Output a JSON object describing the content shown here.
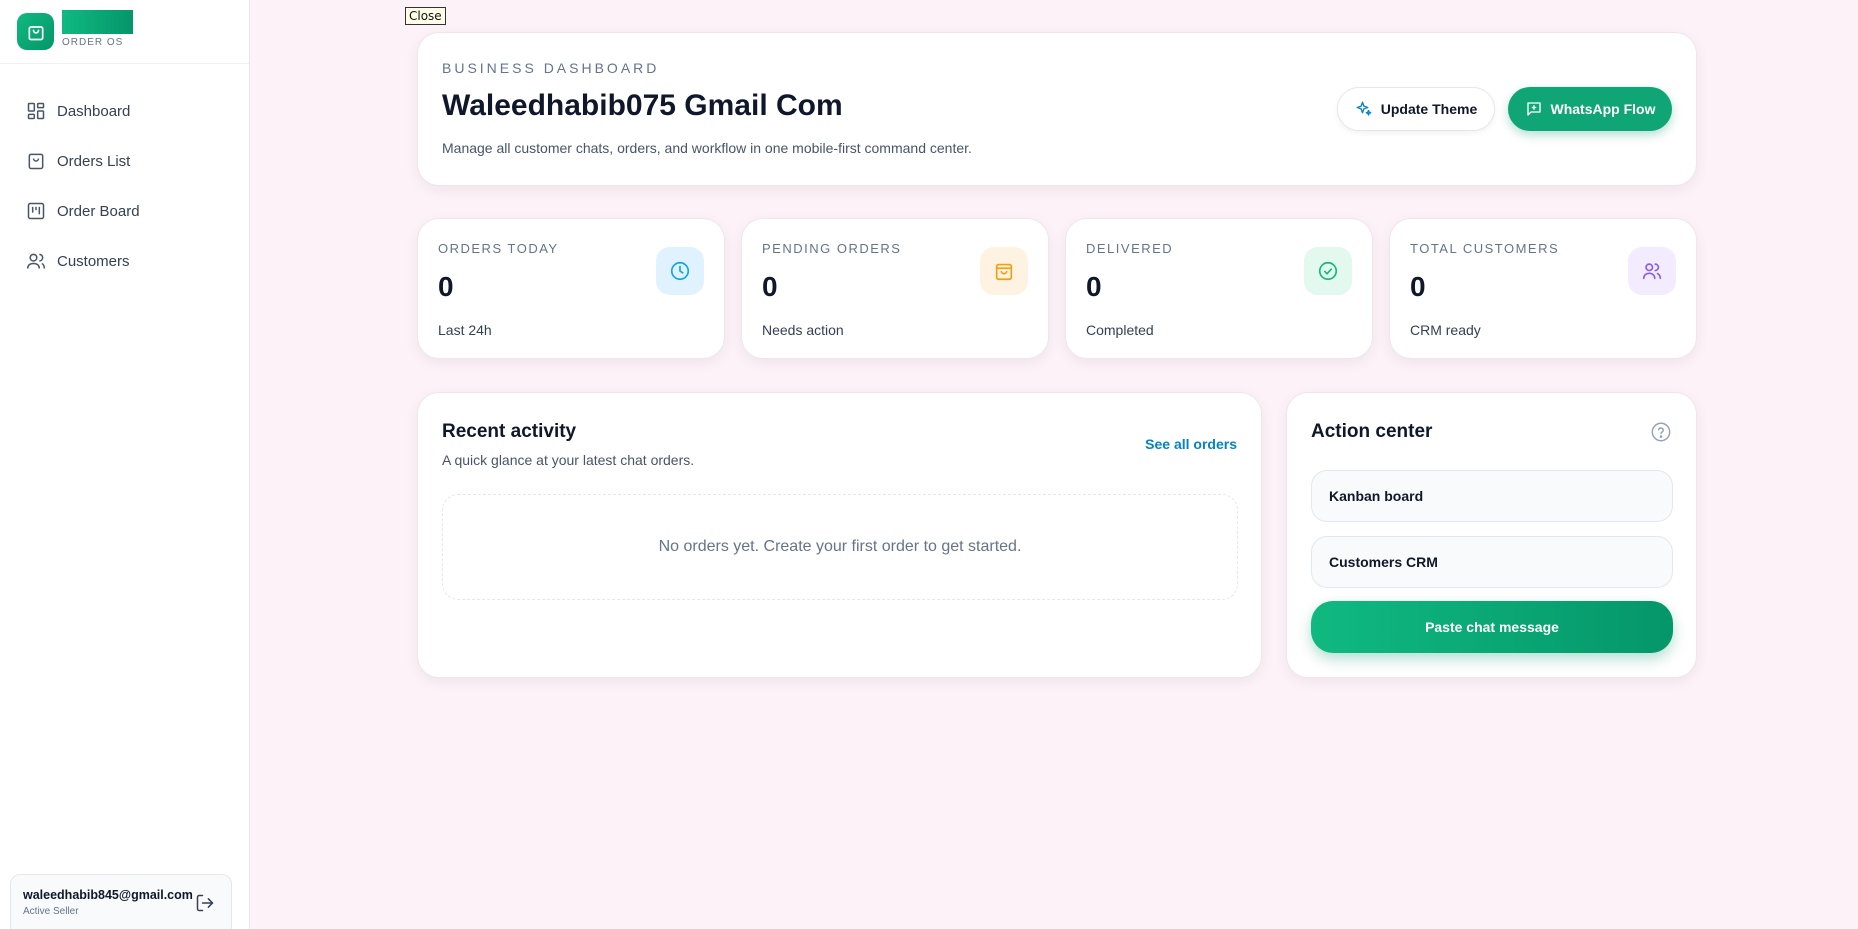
{
  "brand": {
    "subtitle": "ORDER OS",
    "accent": "#10b981"
  },
  "sidebar": {
    "items": [
      {
        "label": "Dashboard",
        "icon": "dashboard-grid-icon"
      },
      {
        "label": "Orders List",
        "icon": "shopping-bag-icon"
      },
      {
        "label": "Order Board",
        "icon": "kanban-icon"
      },
      {
        "label": "Customers",
        "icon": "users-icon"
      }
    ],
    "user": {
      "email": "waleedhabib845@gmail.com",
      "role": "Active Seller"
    }
  },
  "overlay": {
    "close_label": "Close"
  },
  "hero": {
    "eyebrow": "BUSINESS DASHBOARD",
    "title": "Waleedhabib075 Gmail Com",
    "description": "Manage all customer chats, orders, and workflow in one mobile-first command center.",
    "theme_button": "Update Theme",
    "whatsapp_button": "WhatsApp Flow"
  },
  "stats": [
    {
      "label": "ORDERS TODAY",
      "value": "0",
      "sub": "Last 24h",
      "icon": "clock-icon",
      "color": "#0ea5e9",
      "bg": "#e0f2fe"
    },
    {
      "label": "PENDING ORDERS",
      "value": "0",
      "sub": "Needs action",
      "icon": "shopping-bag-icon",
      "color": "#f59e0b",
      "bg": "#fef3e2"
    },
    {
      "label": "DELIVERED",
      "value": "0",
      "sub": "Completed",
      "icon": "check-circle-icon",
      "color": "#10b981",
      "bg": "#e3f8ef"
    },
    {
      "label": "TOTAL CUSTOMERS",
      "value": "0",
      "sub": "CRM ready",
      "icon": "users-icon",
      "color": "#8b5cf6",
      "bg": "#f3ecfe"
    }
  ],
  "recent": {
    "title": "Recent activity",
    "description": "A quick glance at your latest chat orders.",
    "see_all": "See all orders",
    "empty": "No orders yet. Create your first order to get started."
  },
  "action_center": {
    "title": "Action center",
    "items": [
      "Kanban board",
      "Customers CRM"
    ],
    "primary": "Paste chat message"
  }
}
